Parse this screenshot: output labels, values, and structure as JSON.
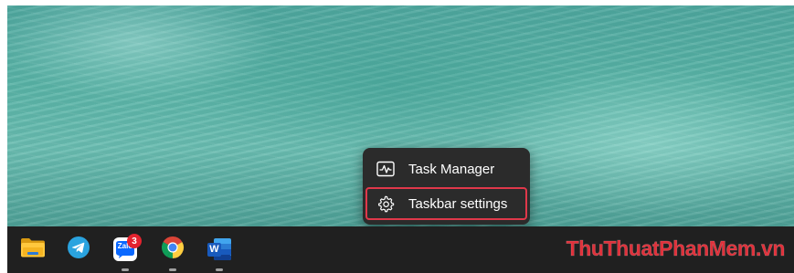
{
  "context_menu": {
    "items": [
      {
        "label": "Task Manager",
        "icon": "pulse-icon"
      },
      {
        "label": "Taskbar settings",
        "icon": "gear-icon"
      }
    ],
    "highlight_color": "#e0384a"
  },
  "taskbar": {
    "apps": [
      {
        "name": "File Explorer",
        "icon": "folder-icon"
      },
      {
        "name": "Telegram",
        "icon": "telegram-icon"
      },
      {
        "name": "Zalo",
        "icon": "zalo-icon",
        "icon_text": "Zalo",
        "badge": "3"
      },
      {
        "name": "Google Chrome",
        "icon": "chrome-icon"
      },
      {
        "name": "Microsoft Word",
        "icon": "word-icon",
        "icon_text": "W"
      }
    ]
  },
  "watermark": {
    "parts": [
      {
        "text": "Thu",
        "color": "#e0303a"
      },
      {
        "text": "Thuat",
        "color": "#e0303a"
      },
      {
        "text": "Phan",
        "color": "#e0303a"
      },
      {
        "text": "Mem",
        "color": "#e0303a"
      },
      {
        "text": ".vn",
        "color": "#e0303a"
      }
    ]
  },
  "colors": {
    "taskbar_bg": "#202020",
    "menu_bg": "#2b2b2b",
    "badge_bg": "#e4232f"
  }
}
